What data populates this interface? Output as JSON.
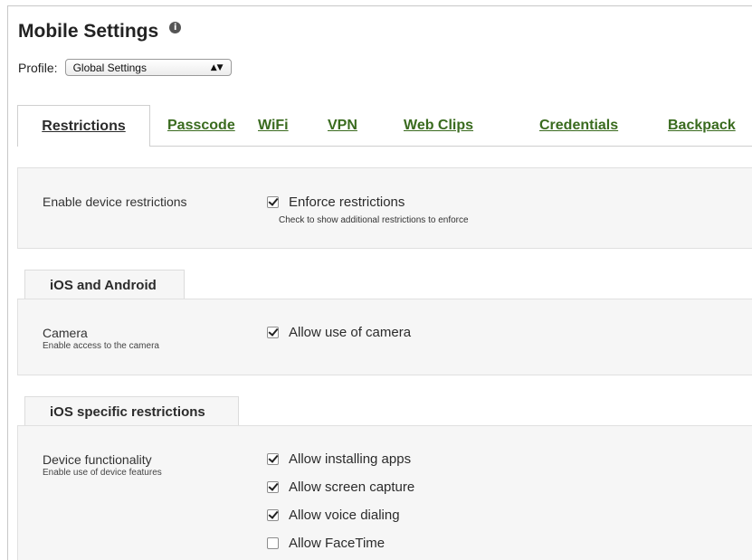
{
  "header": {
    "title": "Mobile Settings",
    "info_icon": "info-icon"
  },
  "profile": {
    "label": "Profile:",
    "selected": "Global Settings"
  },
  "tabs": [
    {
      "label": "Restrictions",
      "active": true
    },
    {
      "label": "Passcode"
    },
    {
      "label": "WiFi"
    },
    {
      "label": "VPN"
    },
    {
      "label": "Web Clips"
    },
    {
      "label": "Credentials"
    },
    {
      "label": "Backpack"
    }
  ],
  "restrictions": {
    "label": "Enable device restrictions",
    "checkbox": {
      "label": "Enforce restrictions",
      "checked": true
    },
    "hint": "Check to show additional restrictions to enforce"
  },
  "ios_android": {
    "section_title": "iOS and Android",
    "camera": {
      "label": "Camera",
      "sub": "Enable access to the camera",
      "checkbox": {
        "label": "Allow use of camera",
        "checked": true
      }
    }
  },
  "ios_specific": {
    "section_title": "iOS specific restrictions",
    "device": {
      "label": "Device functionality",
      "sub": "Enable use of device features",
      "options": [
        {
          "label": "Allow installing apps",
          "checked": true
        },
        {
          "label": "Allow screen capture",
          "checked": true
        },
        {
          "label": "Allow voice dialing",
          "checked": true
        },
        {
          "label": "Allow FaceTime",
          "checked": false
        }
      ]
    }
  },
  "colors": {
    "link_green": "#3a6b1f",
    "panel_bg": "#f6f6f6"
  }
}
